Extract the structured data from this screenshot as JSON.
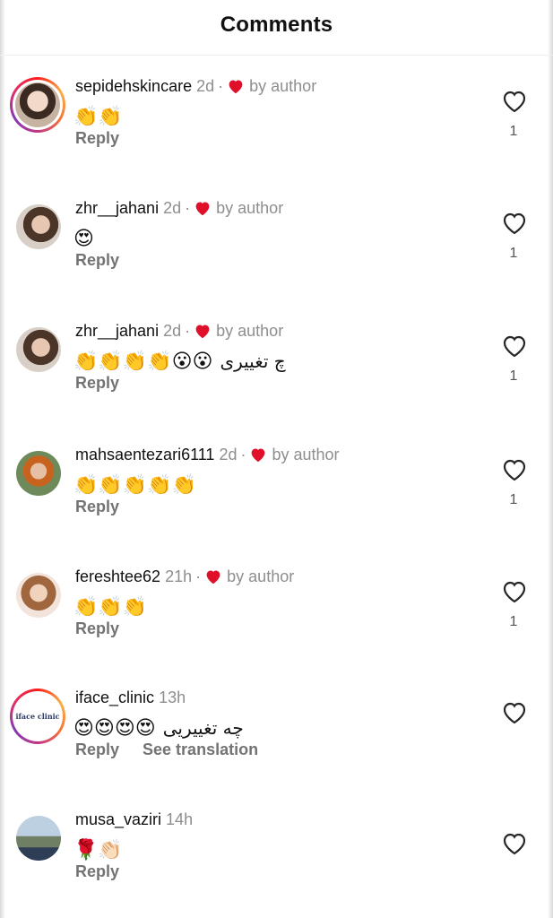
{
  "header": {
    "title": "Comments"
  },
  "comments": [
    {
      "username": "sepidehskincare",
      "time": "2d",
      "liked_by": "by author",
      "emojis": "👏👏",
      "text": "",
      "reply": "Reply",
      "translate": "",
      "likes": "1"
    },
    {
      "username": "zhr__jahani",
      "time": "2d",
      "liked_by": "by author",
      "emojis": "😍",
      "text": "",
      "reply": "Reply",
      "translate": "",
      "likes": "1"
    },
    {
      "username": "zhr__jahani",
      "time": "2d",
      "liked_by": "by author",
      "emojis": "👏👏👏👏😮😮",
      "text": "چ تغییری",
      "reply": "Reply",
      "translate": "",
      "likes": "1"
    },
    {
      "username": "mahsaentezari6111",
      "time": "2d",
      "liked_by": "by author",
      "emojis": "👏👏👏👏👏",
      "text": "",
      "reply": "Reply",
      "translate": "",
      "likes": "1"
    },
    {
      "username": "fereshtee62",
      "time": "21h",
      "liked_by": "by author",
      "emojis": "👏👏👏",
      "text": "",
      "reply": "Reply",
      "translate": "",
      "likes": "1"
    },
    {
      "username": "iface_clinic",
      "time": "13h",
      "liked_by": "",
      "emojis": "😍😍😍😍",
      "text": "چه تغییریی",
      "reply": "Reply",
      "translate": "See translation",
      "likes": ""
    },
    {
      "username": "musa_vaziri",
      "time": "14h",
      "liked_by": "",
      "emojis": "🌹👏🏻",
      "text": "",
      "reply": "Reply",
      "translate": "",
      "likes": ""
    }
  ],
  "logo_text": "iface clinic",
  "colors": {
    "heart_red": "#e0102a",
    "muted": "#8e8e8e",
    "ring_start": "#fd1d1d",
    "ring_end": "#833ab4"
  }
}
